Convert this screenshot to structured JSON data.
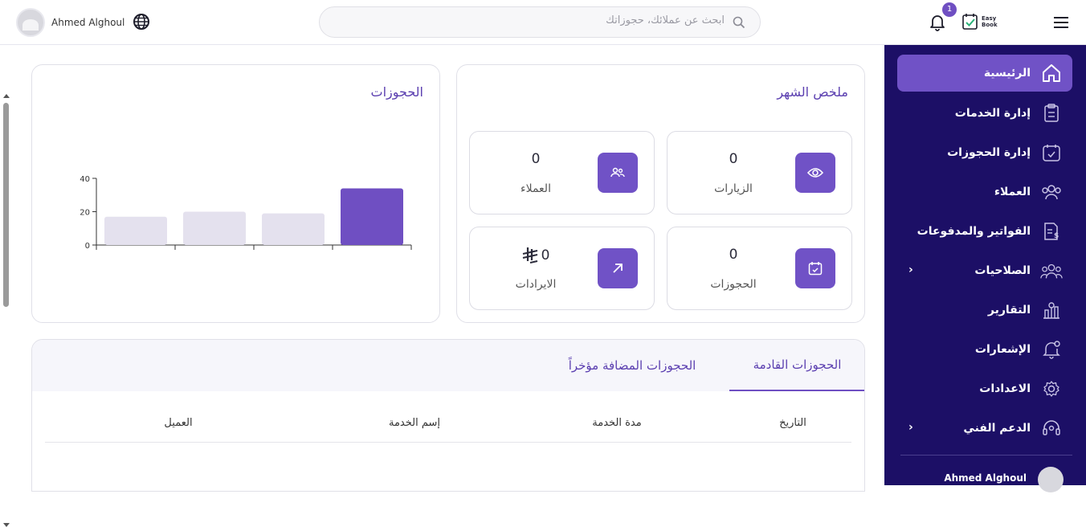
{
  "topbar": {
    "user_name": "Ahmed Alghoul",
    "search_placeholder": "ابحث عن عملائك، حجوزاتك",
    "notification_count": "1",
    "logo_line1": "Easy",
    "logo_line2": "Book"
  },
  "sidebar": {
    "items": [
      {
        "label": "الرئيسية",
        "icon": "home-icon"
      },
      {
        "label": "إدارة الخدمات",
        "icon": "clipboard-icon"
      },
      {
        "label": "إدارة الحجوزات",
        "icon": "calendar-check-icon"
      },
      {
        "label": "العملاء",
        "icon": "users-icon"
      },
      {
        "label": "الفواتير والمدفوعات",
        "icon": "invoice-icon"
      },
      {
        "label": "الصلاحيات",
        "icon": "roles-icon"
      },
      {
        "label": "التقارير",
        "icon": "reports-icon"
      },
      {
        "label": "الإشعارات",
        "icon": "bell-icon"
      },
      {
        "label": "الاعدادات",
        "icon": "gear-icon"
      },
      {
        "label": "الدعم الفني",
        "icon": "headset-icon"
      }
    ],
    "user_name": "Ahmed Alghoul"
  },
  "summary": {
    "title": "ملخص الشهر",
    "stats": [
      {
        "label": "الزيارات",
        "value": "0",
        "icon": "eye-icon"
      },
      {
        "label": "العملاء",
        "value": "0",
        "icon": "users-icon"
      },
      {
        "label": "الحجوزات",
        "value": "0",
        "icon": "calendar-icon"
      },
      {
        "label": "الايرادات",
        "value": "0",
        "icon": "arrow-up-right-icon"
      }
    ]
  },
  "bookings_chart": {
    "title": "الحجوزات"
  },
  "chart_data": {
    "type": "bar",
    "title": "الحجوزات",
    "categories": [
      "",
      "",
      "",
      ""
    ],
    "values": [
      17,
      20,
      19,
      34
    ],
    "ylim": [
      0,
      40
    ],
    "yticks": [
      "0",
      "20",
      "40"
    ],
    "highlight_color": "#6f4fc2",
    "bar_color": "#e4e1ee"
  },
  "table": {
    "tabs": [
      "الحجوزات القادمة",
      "الحجوزات المضافة مؤخراً"
    ],
    "columns": [
      "التاريخ",
      "مدة الخدمة",
      "إسم الخدمة",
      "العميل"
    ]
  },
  "colors": {
    "accent": "#7052c6",
    "sidebar_bg": "#1c0f66"
  }
}
